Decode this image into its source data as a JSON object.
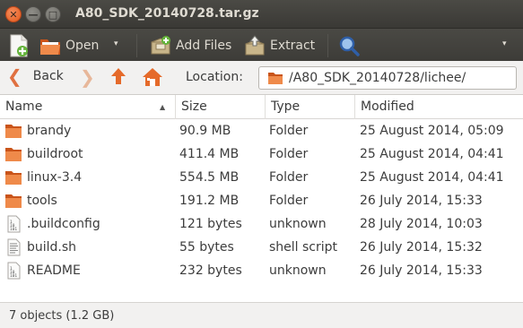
{
  "window": {
    "title": "A80_SDK_20140728.tar.gz",
    "close": "✕",
    "minimize": "—",
    "maximize": "□"
  },
  "toolbar": {
    "new_icon": "new-archive-icon",
    "open_label": "Open",
    "open_arrow": "▾",
    "add_files_label": "Add Files",
    "extract_label": "Extract",
    "search_icon": "magnifier-icon",
    "menu_arrow": "▾"
  },
  "navigation": {
    "back_arrow": "❮",
    "back_label": "Back",
    "forward_arrow": "❯",
    "up_arrow": "🡑",
    "location_label": "Location:",
    "location_value": "/A80_SDK_20140728/lichee/"
  },
  "columns": {
    "name": "Name",
    "size": "Size",
    "type": "Type",
    "modified": "Modified",
    "sort": "▲"
  },
  "files": [
    {
      "icon": "folder",
      "name": "brandy",
      "size": "90.9 MB",
      "type": "Folder",
      "modified": "25 August 2014, 05:09"
    },
    {
      "icon": "folder",
      "name": "buildroot",
      "size": "411.4 MB",
      "type": "Folder",
      "modified": "25 August 2014, 04:41"
    },
    {
      "icon": "folder",
      "name": "linux-3.4",
      "size": "554.5 MB",
      "type": "Folder",
      "modified": "25 August 2014, 04:41"
    },
    {
      "icon": "folder",
      "name": "tools",
      "size": "191.2 MB",
      "type": "Folder",
      "modified": "26 July 2014, 15:33"
    },
    {
      "icon": "binary",
      "name": ".buildconfig",
      "size": "121 bytes",
      "type": "unknown",
      "modified": "28 July 2014, 10:03"
    },
    {
      "icon": "script",
      "name": "build.sh",
      "size": "55 bytes",
      "type": "shell script",
      "modified": "26 July 2014, 15:32"
    },
    {
      "icon": "binary",
      "name": "README",
      "size": "232 bytes",
      "type": "unknown",
      "modified": "26 July 2014, 15:33"
    }
  ],
  "status": {
    "text": "7 objects (1.2 GB)"
  },
  "colors": {
    "accent": "#e56a2a",
    "folder": "#e8762c",
    "titlebar": "#3c3b37"
  }
}
